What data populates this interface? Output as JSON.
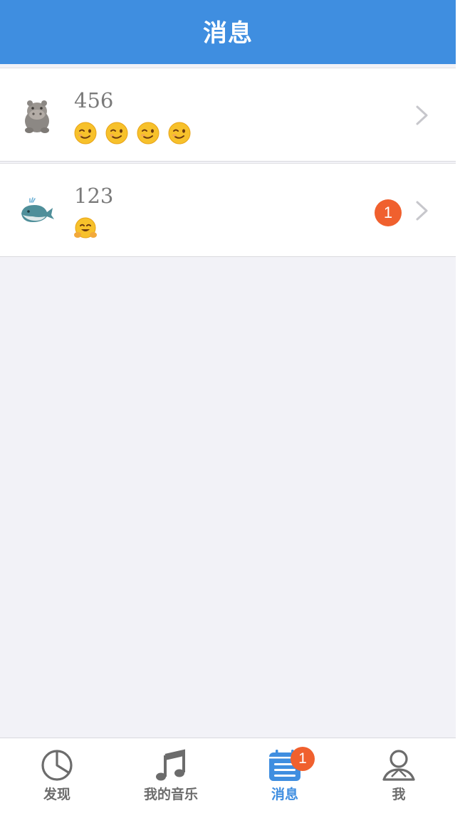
{
  "header": {
    "title": "消息"
  },
  "conversations": [
    {
      "name": "456",
      "avatar_icon": "hippo-avatar-icon",
      "message_emoji": [
        "winking-face",
        "winking-face",
        "winking-face",
        "winking-face"
      ],
      "unread_count": null
    },
    {
      "name": "123",
      "avatar_icon": "whale-avatar-icon",
      "message_emoji": [
        "hugging-face"
      ],
      "unread_count": "1"
    }
  ],
  "tabbar": {
    "tabs": [
      {
        "label": "发现",
        "icon": "pie-chart-icon",
        "active": false
      },
      {
        "label": "我的音乐",
        "icon": "music-note-icon",
        "active": false
      },
      {
        "label": "消息",
        "icon": "message-list-icon",
        "active": true,
        "badge": "1"
      },
      {
        "label": "我",
        "icon": "person-icon",
        "active": false
      }
    ]
  },
  "colors": {
    "brand": "#3f8ee0",
    "badge": "#f0602e",
    "background": "#f2f2f7",
    "text_secondary": "#7a7a7a"
  }
}
